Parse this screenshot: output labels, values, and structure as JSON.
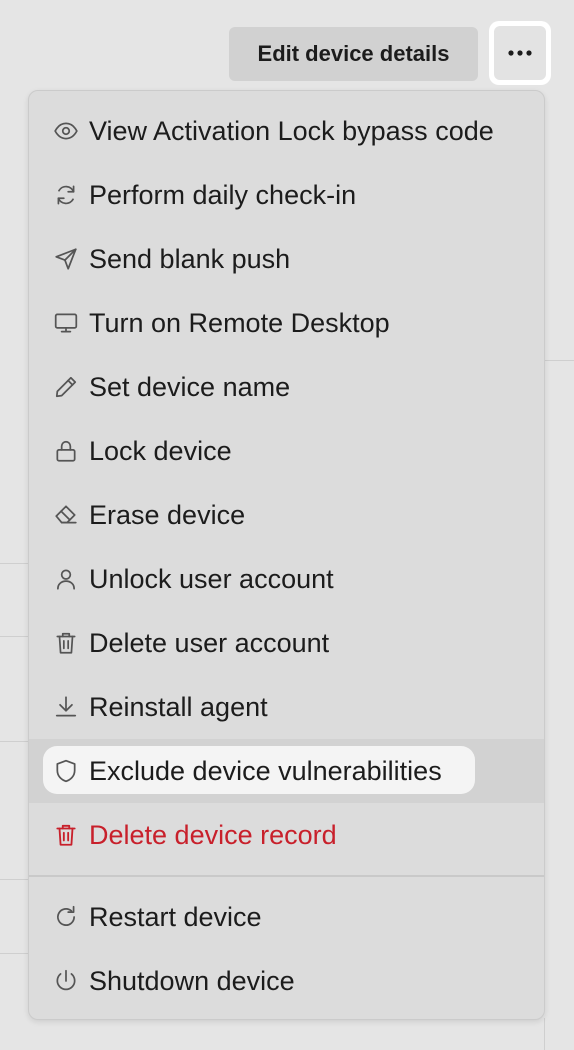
{
  "header": {
    "edit_button_label": "Edit device details",
    "more_button_icon": "ellipsis-icon"
  },
  "menu": {
    "items": [
      {
        "label": "View Activation Lock bypass code",
        "icon": "eye-icon"
      },
      {
        "label": "Perform daily check-in",
        "icon": "refresh-icon"
      },
      {
        "label": "Send blank push",
        "icon": "send-icon"
      },
      {
        "label": "Turn on Remote Desktop",
        "icon": "monitor-icon"
      },
      {
        "label": "Set device name",
        "icon": "pencil-icon"
      },
      {
        "label": "Lock device",
        "icon": "lock-icon"
      },
      {
        "label": "Erase device",
        "icon": "eraser-icon"
      },
      {
        "label": "Unlock user account",
        "icon": "user-icon"
      },
      {
        "label": "Delete user account",
        "icon": "trash-icon"
      },
      {
        "label": "Reinstall agent",
        "icon": "download-icon"
      },
      {
        "label": "Exclude device vulnerabilities",
        "icon": "shield-icon"
      },
      {
        "label": "Delete device record",
        "icon": "trash-icon"
      },
      {
        "label": "Restart device",
        "icon": "restart-icon"
      },
      {
        "label": "Shutdown device",
        "icon": "power-icon"
      }
    ],
    "highlighted_item": "Exclude device vulnerabilities",
    "danger_color": "#c8202b"
  }
}
